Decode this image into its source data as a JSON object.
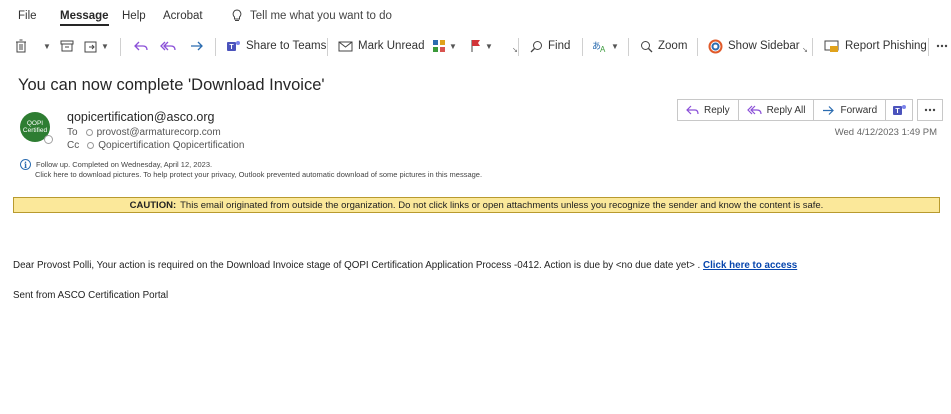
{
  "menu": {
    "items": [
      "File",
      "Message",
      "Help",
      "Acrobat"
    ],
    "active": "Message",
    "tell_me": "Tell me what you want to do"
  },
  "ribbon": {
    "share_to_teams": "Share to Teams",
    "mark_unread": "Mark Unread",
    "find": "Find",
    "zoom": "Zoom",
    "show_sidebar": "Show Sidebar",
    "report_phishing": "Report Phishing"
  },
  "message": {
    "subject": "You can now complete 'Download Invoice'",
    "avatar_text": "QOPI Certified",
    "sender": "qopicertification@asco.org",
    "to_label": "To",
    "to": "provost@armaturecorp.com",
    "cc_label": "Cc",
    "cc": "Qopicertification Qopicertification",
    "followup": "Follow up.  Completed on Wednesday, April 12, 2023.",
    "download_notice": "Click here to download pictures. To help protect your privacy, Outlook prevented automatic download of some pictures in this message.",
    "date": "Wed 4/12/2023 1:49 PM"
  },
  "actions": {
    "reply": "Reply",
    "reply_all": "Reply All",
    "forward": "Forward"
  },
  "caution": {
    "label": "CAUTION:",
    "text": "This email originated from outside the organization. Do not click links or open attachments unless you recognize the sender and know the content is safe."
  },
  "body": {
    "text": "Dear Provost Polli, Your action is required on the Download Invoice stage of QOPI Certification Application Process -0412. Action is due by <no due date yet> . ",
    "link": "Click here to access",
    "signature": "Sent from ASCO Certification Portal"
  },
  "colors": {
    "caution_bg": "#fbe89a",
    "link": "#0645ad",
    "teams": "#4b53bc",
    "avatar": "#2e7d32"
  }
}
